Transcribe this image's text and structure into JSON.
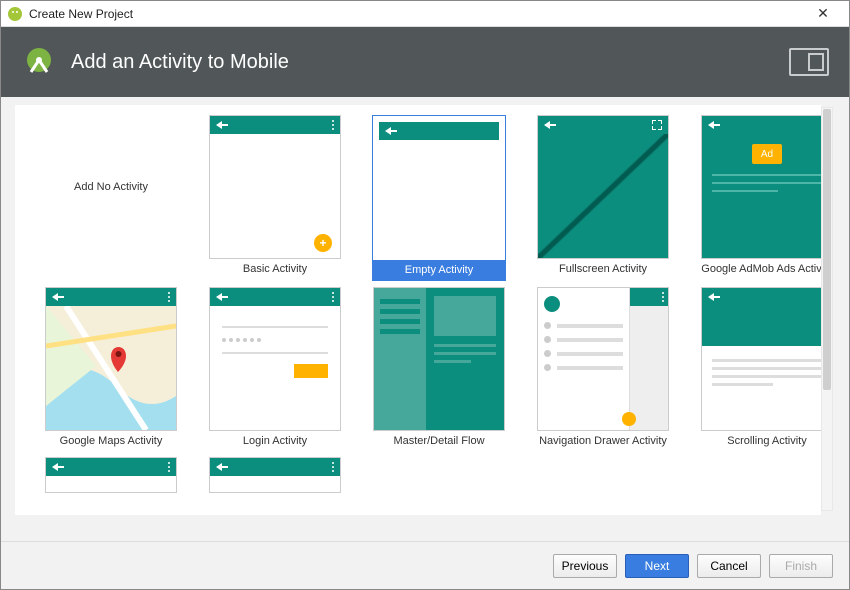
{
  "titlebar": {
    "title": "Create New Project"
  },
  "header": {
    "page_title": "Add an Activity to Mobile"
  },
  "templates": [
    {
      "label": "Add No Activity"
    },
    {
      "label": "Basic Activity"
    },
    {
      "label": "Empty Activity"
    },
    {
      "label": "Fullscreen Activity"
    },
    {
      "label": "Google AdMob Ads Activity",
      "ad_text": "Ad"
    },
    {
      "label": "Google Maps Activity"
    },
    {
      "label": "Login Activity"
    },
    {
      "label": "Master/Detail Flow"
    },
    {
      "label": "Navigation Drawer Activity"
    },
    {
      "label": "Scrolling Activity"
    }
  ],
  "footer": {
    "previous": "Previous",
    "next": "Next",
    "cancel": "Cancel",
    "finish": "Finish"
  }
}
